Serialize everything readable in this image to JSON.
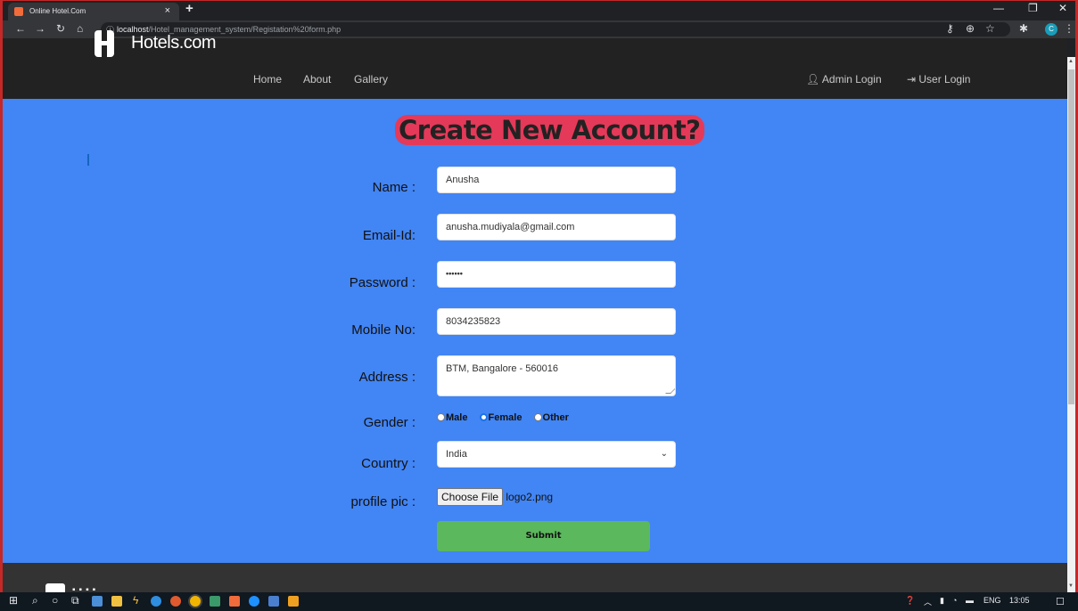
{
  "browser": {
    "tab_title": "Online Hotel.Com",
    "tab_close": "×",
    "new_tab": "+",
    "url_host": "localhost",
    "url_path": "/Hotel_management_system/Registation%20form.php",
    "profile_initial": "C"
  },
  "site": {
    "brand": "Hotels.com",
    "nav": [
      "Home",
      "About",
      "Gallery"
    ],
    "admin_login": "Admin Login",
    "user_login": "User Login"
  },
  "form": {
    "heading": "Create New Account?",
    "name_label": "Name :",
    "name_value": "Anusha",
    "email_label": "Email-Id:",
    "email_value": "anusha.mudiyala@gmail.com",
    "password_label": "Password :",
    "password_value": "••••••",
    "mobile_label": "Mobile No:",
    "mobile_value": "8034235823",
    "address_label": "Address :",
    "address_value": "BTM, Bangalore - 560016",
    "gender_label": "Gender :",
    "gender_options": [
      "Male",
      "Female",
      "Other"
    ],
    "gender_selected": "Female",
    "country_label": "Country :",
    "country_value": "India",
    "profile_label": "profile pic :",
    "choose_file": "Choose File",
    "file_name": "logo2.png",
    "submit": "Submit"
  },
  "taskbar": {
    "language": "ENG",
    "time": "13:05"
  },
  "colors": {
    "page_blue": "#4285f4",
    "heading_bg": "#e53959",
    "submit_green": "#5cb85c",
    "nav_dark": "#222222"
  }
}
